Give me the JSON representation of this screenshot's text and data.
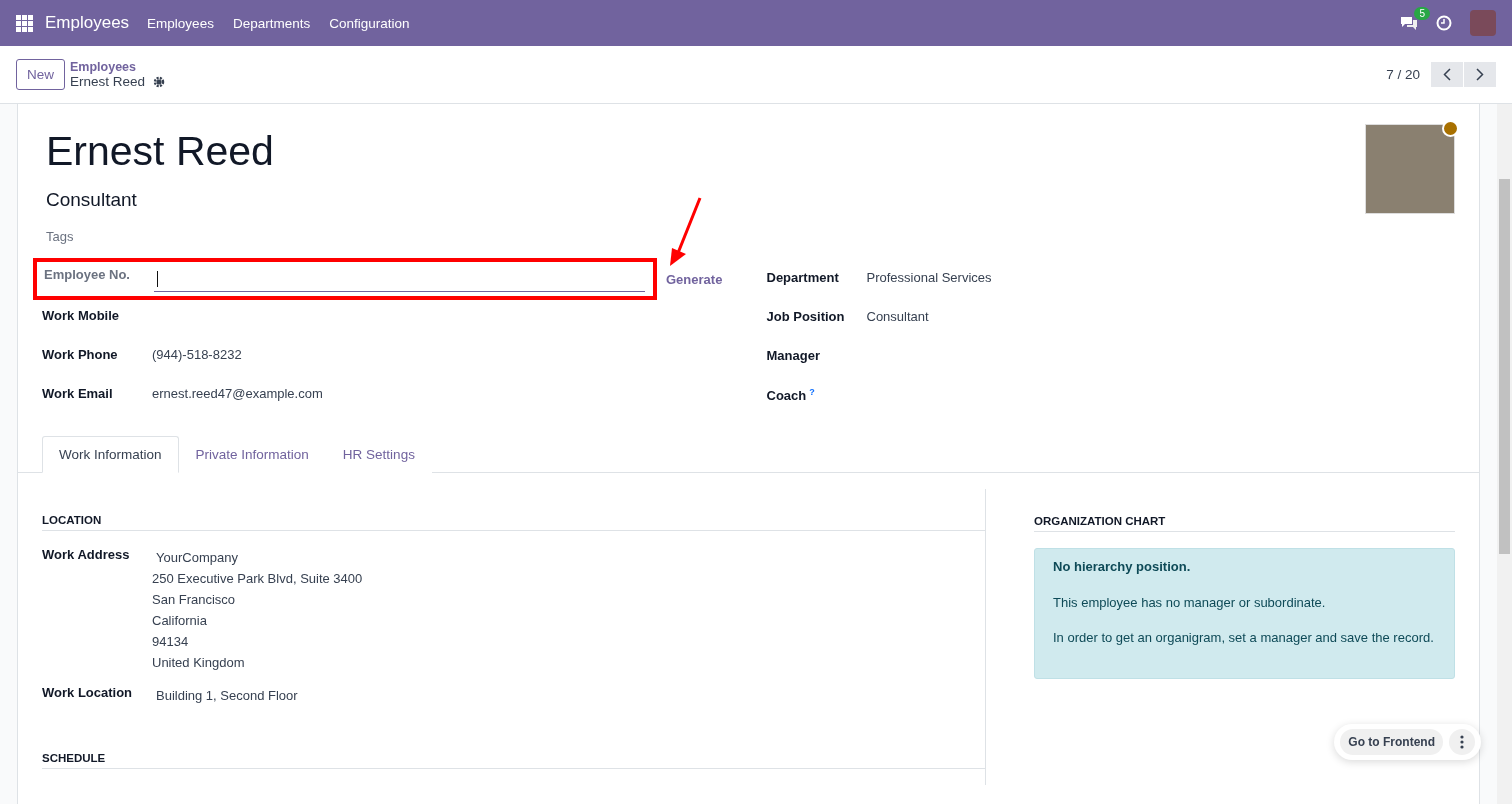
{
  "navbar": {
    "app_name": "Employees",
    "menu": [
      "Employees",
      "Departments",
      "Configuration"
    ],
    "messages_badge": "5"
  },
  "control_panel": {
    "new_button": "New",
    "breadcrumb_parent": "Employees",
    "breadcrumb_current": "Ernest Reed",
    "pager": "7 / 20"
  },
  "employee": {
    "name": "Ernest Reed",
    "job_title": "Consultant",
    "tags_placeholder": "Tags"
  },
  "fields_left": [
    {
      "kind": "input",
      "label": "Employee No.",
      "focused": true,
      "highlighted": true,
      "action": "Generate"
    },
    {
      "kind": "text",
      "label": "Work Mobile"
    },
    {
      "kind": "text",
      "label": "Work Phone",
      "value": "(944)-518-8232"
    },
    {
      "kind": "text",
      "label": "Work Email",
      "value": "ernest.reed47@example.com"
    }
  ],
  "fields_right": [
    {
      "label": "Department",
      "value": "Professional Services"
    },
    {
      "label": "Job Position",
      "value": "Consultant"
    },
    {
      "label": "Manager"
    },
    {
      "label": "Coach",
      "help": "?"
    }
  ],
  "tabs": [
    {
      "label": "Work Information",
      "selected": true
    },
    {
      "label": "Private Information",
      "selected": false
    },
    {
      "label": "HR Settings",
      "selected": false
    }
  ],
  "location": {
    "title": "LOCATION",
    "work_address_label": "Work Address",
    "work_address": [
      "YourCompany",
      "250 Executive Park Blvd, Suite 3400",
      "San Francisco",
      "California",
      "94134",
      "United Kingdom"
    ],
    "work_location_label": "Work Location",
    "work_location": "Building 1, Second Floor"
  },
  "schedule": {
    "title": "SCHEDULE"
  },
  "organization_chart": {
    "title": "ORGANIZATION CHART",
    "heading": "No hierarchy position.",
    "paragraphs": [
      "This employee has no manager or subordinate.",
      "In order to get an organigram, set a manager and save the record."
    ]
  },
  "floating_button": "Go to Frontend"
}
